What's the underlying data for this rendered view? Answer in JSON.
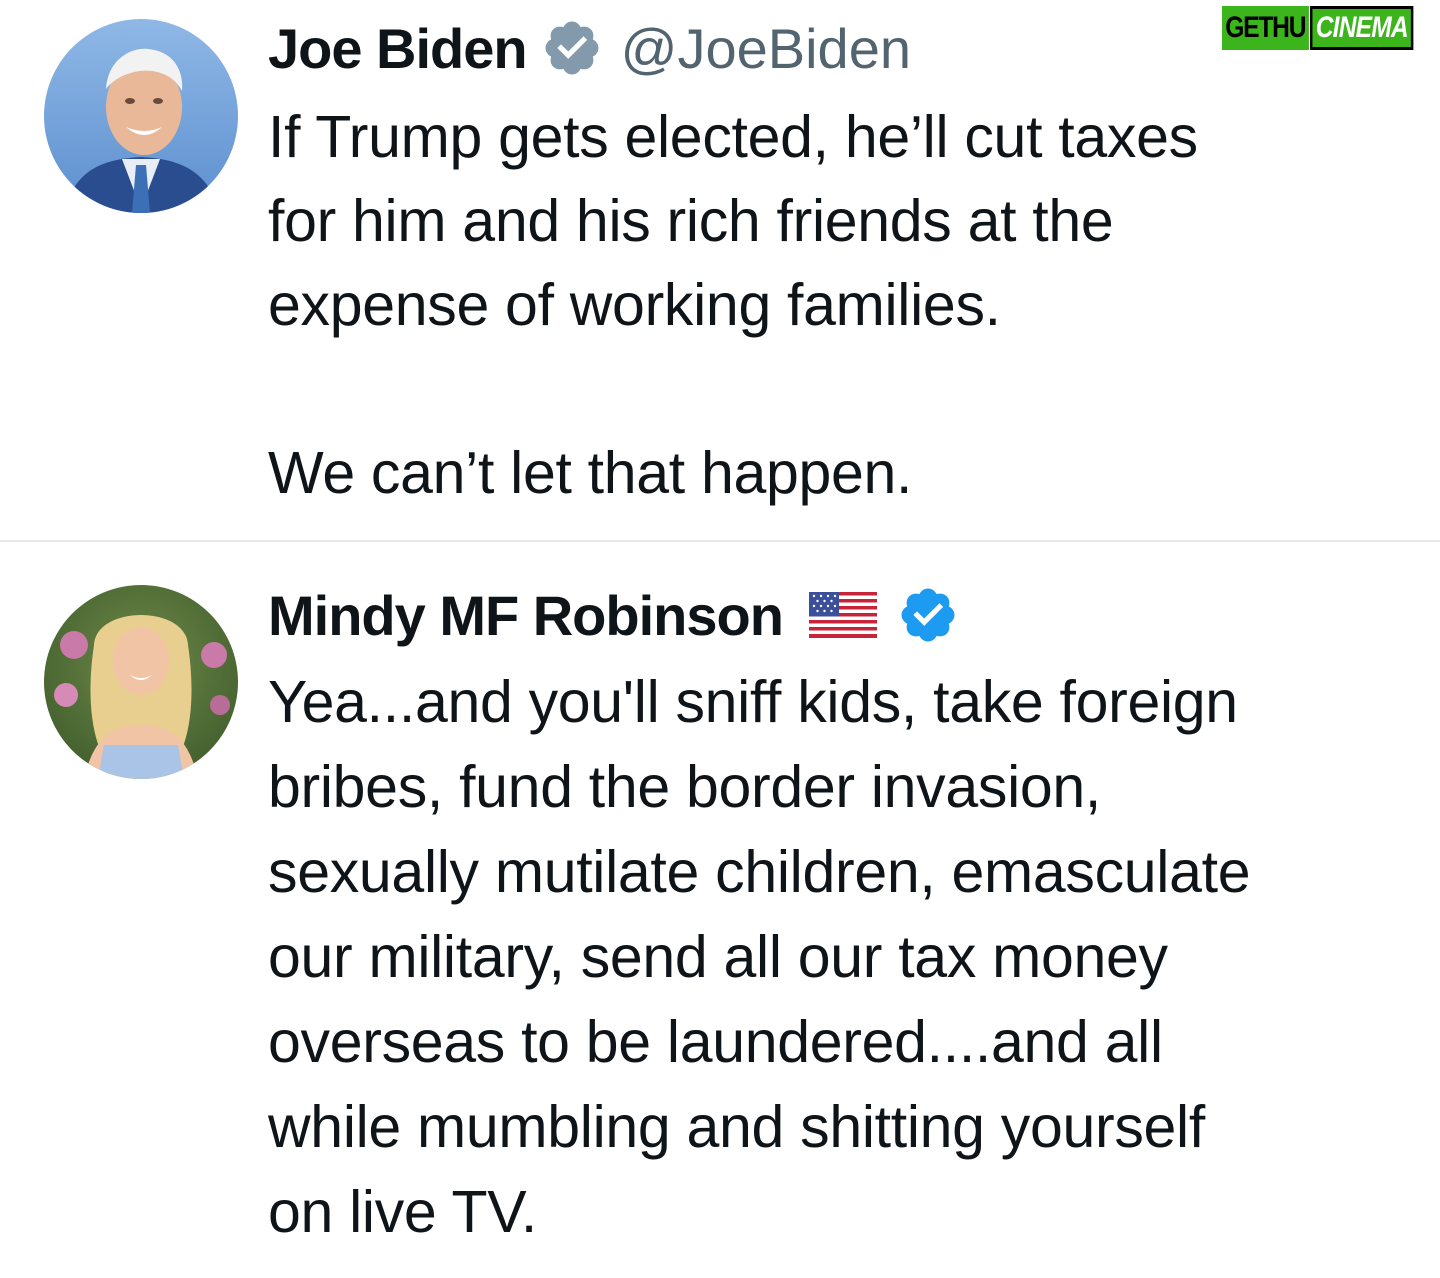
{
  "watermark": {
    "left_text": "GETHU",
    "right_text": "CINEMA"
  },
  "tweets": [
    {
      "author_name": "Joe Biden",
      "verified_badge": "gray-verified-icon",
      "handle": "@JoeBiden",
      "text": "If Trump gets elected, he’ll cut taxes\nfor him and his rich friends at the\nexpense of working families.\n\nWe can’t let that happen."
    },
    {
      "author_name": "Mindy MF Robinson",
      "flag": "us-flag-icon",
      "verified_badge": "blue-verified-icon",
      "text": "Yea...and you'll sniff kids, take foreign\nbribes, fund the border invasion,\nsexually mutilate children, emasculate\nour military, send all our tax money\noverseas to be laundered....and all\nwhile mumbling and shitting yourself\non live TV."
    }
  ],
  "colors": {
    "text": "#0f1419",
    "handle": "#536471",
    "gray_badge": "#829aab",
    "blue_badge": "#1d9bf0",
    "divider": "#e6e8ea",
    "watermark_green": "#3cb51c"
  }
}
